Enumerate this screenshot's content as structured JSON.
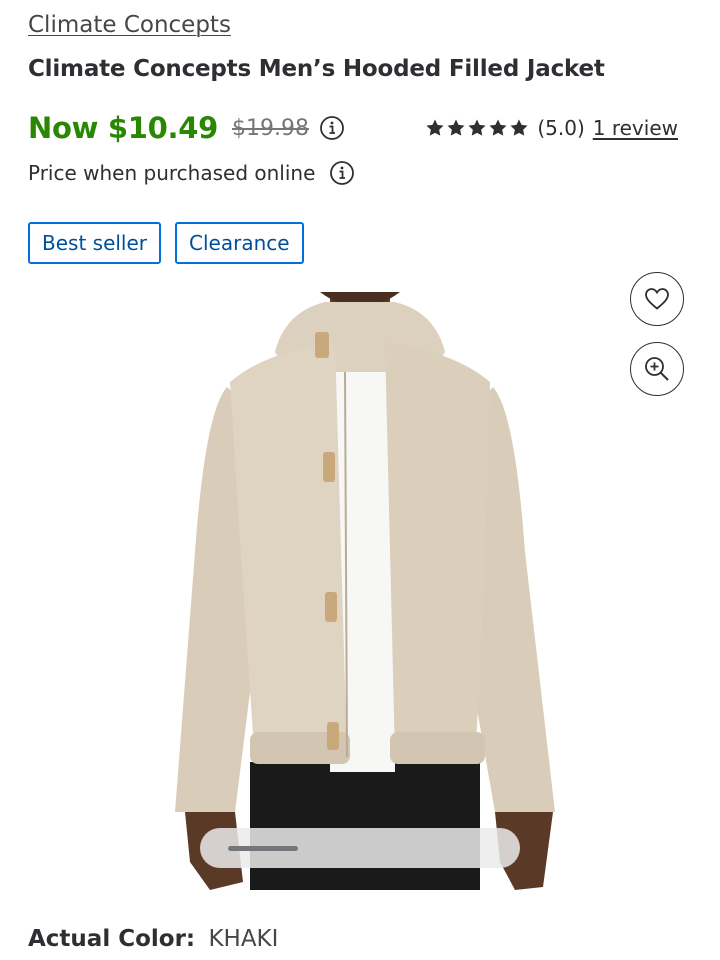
{
  "product": {
    "brand": "Climate Concepts",
    "title": "Climate Concepts Men’s Hooded Filled Jacket",
    "now_price": "Now $10.49",
    "was_price": "$19.98",
    "rating_value": 5.0,
    "rating_text": "(5.0)",
    "review_link": "1 review",
    "price_note": "Price when purchased online",
    "badges": [
      "Best seller",
      "Clearance"
    ],
    "actual_color_label": "Actual Color:",
    "actual_color_value": "KHAKI"
  },
  "icons": {
    "price_info": "info-circle-icon",
    "online_info": "info-circle-icon",
    "favorite": "heart-icon",
    "zoom": "zoom-in-icon",
    "star": "star-icon"
  },
  "colors": {
    "price_green": "#2a8703",
    "badge_border": "#0071dc",
    "badge_text": "#004f9a",
    "text": "#2e2f32",
    "muted": "#74767c"
  },
  "gallery": {
    "image": "product-photo-khaki-hooded-jacket",
    "scroll_position": 0.0
  }
}
